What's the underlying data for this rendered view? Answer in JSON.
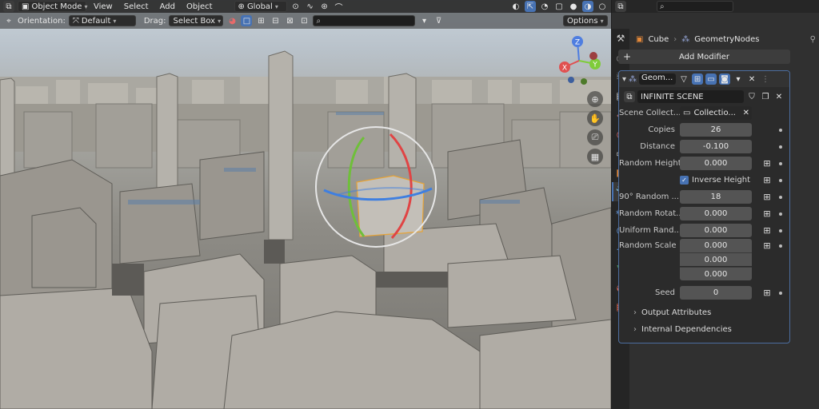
{
  "header": {
    "mode": "Object Mode",
    "menus": [
      "View",
      "Select",
      "Add",
      "Object"
    ],
    "transform_orientation": "Global",
    "orientation_label": "Orientation:",
    "orientation_value": "Default",
    "drag_label": "Drag:",
    "drag_value": "Select Box",
    "options_label": "Options"
  },
  "viewport_gizmo": {
    "x": "X",
    "y": "Y",
    "z": "Z"
  },
  "panel": {
    "breadcrumb": {
      "object": "Cube",
      "modifier": "GeometryNodes"
    },
    "add_modifier": "Add Modifier",
    "modifier_name": "Geom...",
    "node_group": "INFINITE SCENE",
    "fields": {
      "scene_collection_label": "Scene Collect...",
      "scene_collection_value": "Collectio...",
      "copies_label": "Copies",
      "copies_value": "26",
      "distance_label": "Distance",
      "distance_value": "-0.100",
      "random_height_label": "Random Height",
      "random_height_value": "0.000",
      "inverse_height_label": "Inverse Height",
      "random90_label": "90° Random ...",
      "random90_value": "18",
      "random_rot_label": "Random Rotat...",
      "random_rot_value": "0.000",
      "uniform_rand_label": "Uniform Rand...",
      "uniform_rand_value": "0.000",
      "random_scale_label": "Random Scale",
      "random_scale_x": "0.000",
      "random_scale_y": "0.000",
      "random_scale_z": "0.000",
      "seed_label": "Seed",
      "seed_value": "0"
    },
    "subpanels": [
      "Output Attributes",
      "Internal Dependencies"
    ]
  },
  "colors": {
    "accent": "#4772b3",
    "panel_bg": "#303030",
    "field_bg": "#545454"
  }
}
